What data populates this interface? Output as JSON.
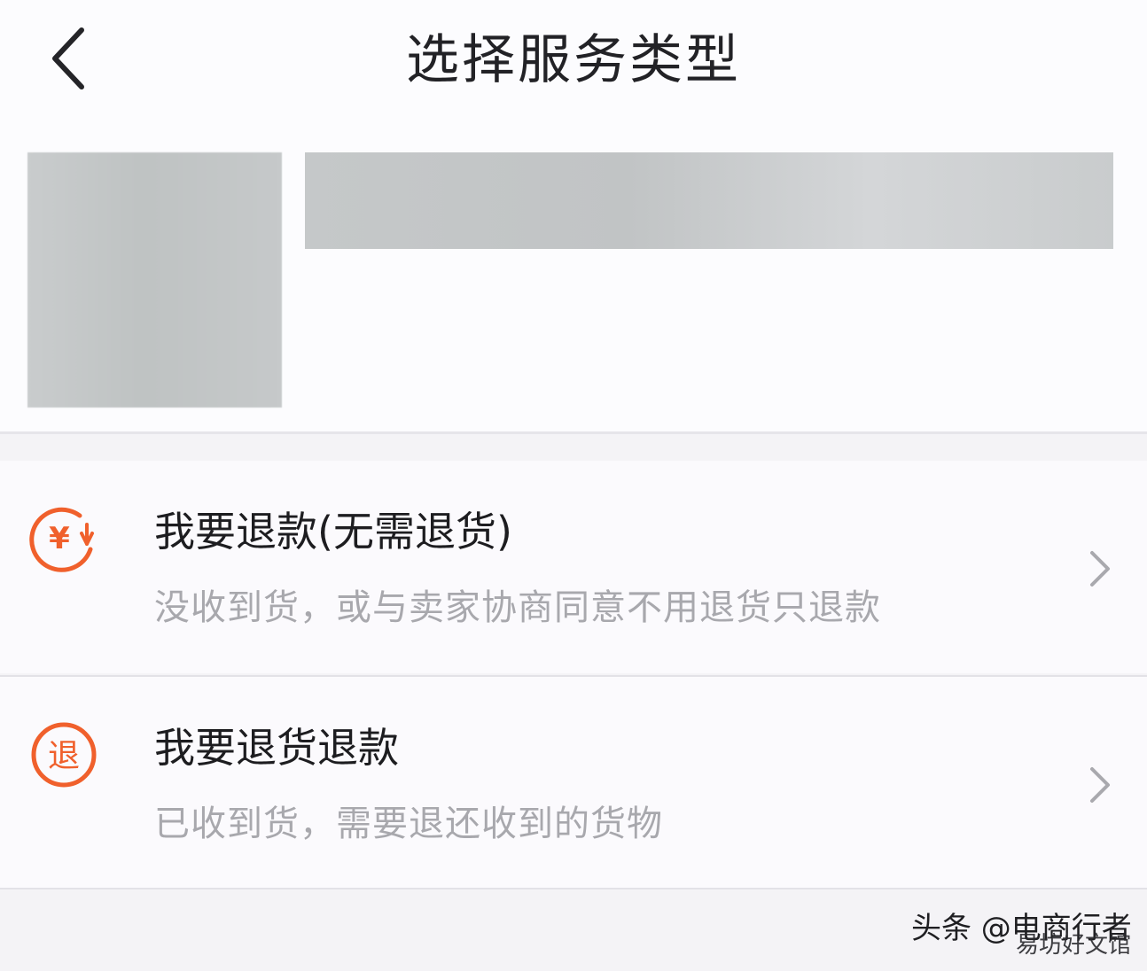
{
  "header": {
    "title": "选择服务类型",
    "back_icon": "chevron-left-icon"
  },
  "options": [
    {
      "title": "我要退款(无需退货)",
      "description": "没收到货，或与卖家协商同意不用退货只退款",
      "icon": "refund-yuan-icon",
      "icon_text": "¥"
    },
    {
      "title": "我要退货退款",
      "description": "已收到货，需要退还收到的货物",
      "icon": "return-icon",
      "icon_text": "退"
    }
  ],
  "colors": {
    "accent": "#f0602c",
    "title_text": "#1d1d20",
    "secondary_text": "#a8a8ad",
    "chevron": "#a9a9ae"
  },
  "watermark": {
    "line1": "头条 @电商行者",
    "line2": "易坊好文馆"
  }
}
